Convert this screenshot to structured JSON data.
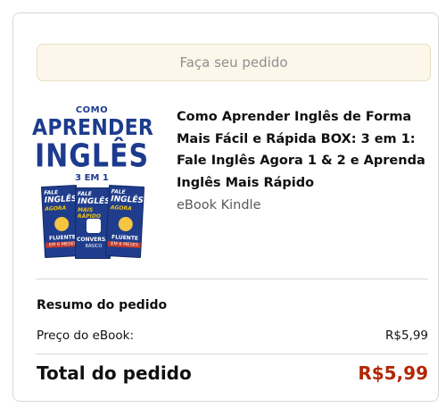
{
  "order": {
    "place_order_label": "Faça seu pedido"
  },
  "product": {
    "title": "Como Aprender Inglês de Forma Mais Fácil e Rápida BOX: 3 em 1: Fale Inglês Agora 1 & 2 e Aprenda Inglês Mais Rápido",
    "format": "eBook Kindle",
    "cover": {
      "line1": "COMO",
      "line2": "APRENDER",
      "line3": "INGLÊS",
      "line4": "3 EM 1",
      "books": [
        {
          "top": "FALE",
          "main": "INGLÊS",
          "sub": "AGORA",
          "foot": "FLUENTE",
          "band": "EM 6 MESES"
        },
        {
          "top": "FALE",
          "main": "INGLÊS",
          "sub": "MAIS RÁPIDO",
          "foot": "CONVERSAÇÃO",
          "band": "BÁSICO"
        },
        {
          "top": "FALE",
          "main": "INGLÊS",
          "sub": "AGORA",
          "foot": "FLUENTE",
          "band": "EM 6 MESES"
        }
      ]
    }
  },
  "summary": {
    "title": "Resumo do pedido",
    "price_label": "Preço do eBook:",
    "price_value": "R$5,99",
    "total_label": "Total do pedido",
    "total_value": "R$5,99"
  },
  "colors": {
    "total_price": "#b12704",
    "button_bg": "#fcf7ea",
    "cover_blue": "#1d3b8e"
  }
}
